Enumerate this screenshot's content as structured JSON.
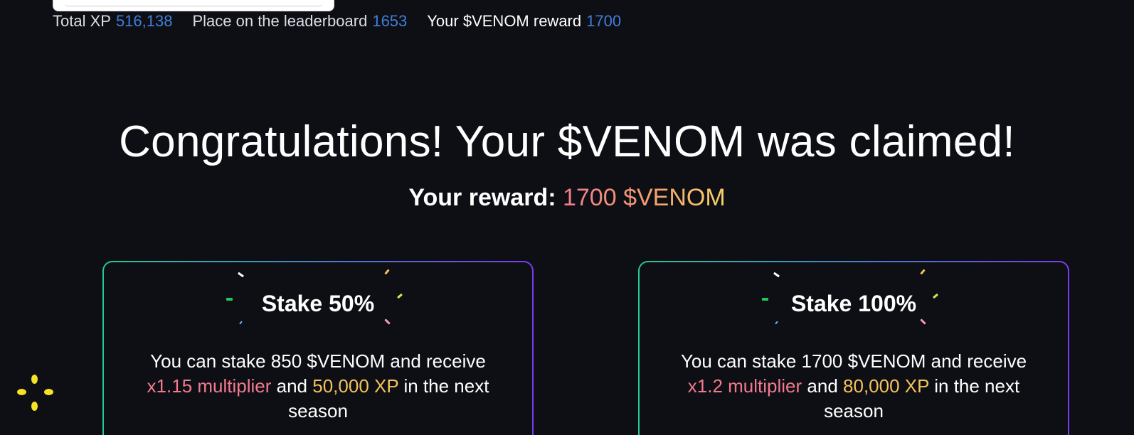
{
  "stats": {
    "total_xp_label": "Total XP",
    "total_xp_value": "516,138",
    "leaderboard_label": "Place on the leaderboard",
    "leaderboard_value": "1653",
    "reward_label": "Your $VENOM reward",
    "reward_value": "1700"
  },
  "headline": "Congratulations! Your $VENOM was claimed!",
  "reward": {
    "label": "Your reward:",
    "amount": "1700 $VENOM"
  },
  "cards": [
    {
      "title": "Stake 50%",
      "desc_prefix": "You can stake 850 $VENOM and receive",
      "multiplier": "x1.15 multiplier",
      "and": "and",
      "xp": "50,000 XP",
      "desc_suffix": "in the next season"
    },
    {
      "title": "Stake 100%",
      "desc_prefix": "You can stake 1700 $VENOM and receive",
      "multiplier": "x1.2 multiplier",
      "and": "and",
      "xp": "80,000 XP",
      "desc_suffix": "in the next season"
    }
  ],
  "colors": {
    "background": "#0e0f14",
    "accent_blue": "#3f7fd9",
    "multiplier_pink": "#f27a8f",
    "xp_gold": "#f6c25a",
    "card_border_start": "#22c89a",
    "card_border_end": "#7b3cf0",
    "loader_yellow": "#f7e223"
  },
  "icons": {
    "loader": "loading-dots-icon",
    "confetti": "confetti-icon"
  }
}
